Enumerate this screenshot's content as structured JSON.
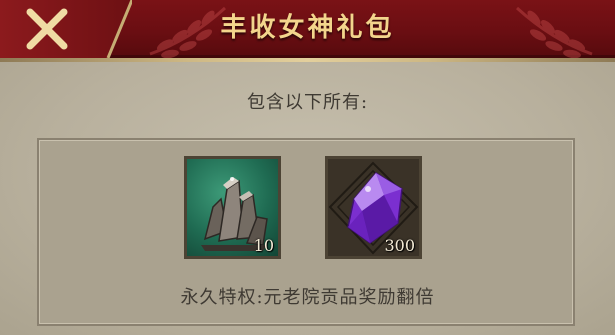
{
  "header": {
    "title": "丰收女神礼包",
    "close_icon": "close-x-icon"
  },
  "content": {
    "intro": "包含以下所有:",
    "privilege": "永久特权:元老院贡品奖励翻倍"
  },
  "items": [
    {
      "icon": "stone-crystal-icon",
      "quantity": "10"
    },
    {
      "icon": "purple-gem-icon",
      "quantity": "300"
    }
  ],
  "colors": {
    "header_red": "#6a0e12",
    "title_gold": "#f3d58c",
    "panel_bg": "#aaa28f",
    "text_dark": "#3f3a33"
  }
}
